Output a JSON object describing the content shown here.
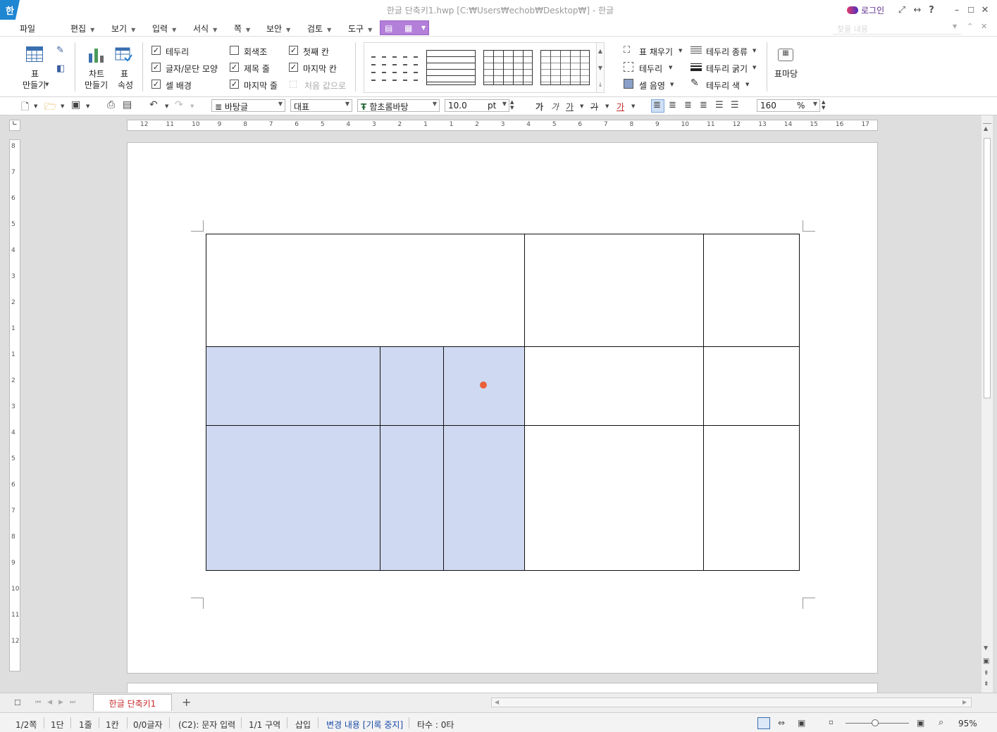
{
  "window": {
    "title": "한글 단축키1.hwp [C:₩Users₩echob₩Desktop₩] - 한글",
    "app_logo": "한",
    "login_label": "로그인"
  },
  "menu": [
    {
      "label": "파일",
      "dropdown": false
    },
    {
      "label": "편집",
      "dropdown": true
    },
    {
      "label": "보기",
      "dropdown": true
    },
    {
      "label": "입력",
      "dropdown": true
    },
    {
      "label": "서식",
      "dropdown": true
    },
    {
      "label": "쪽",
      "dropdown": true
    },
    {
      "label": "보안",
      "dropdown": true
    },
    {
      "label": "검토",
      "dropdown": true
    },
    {
      "label": "도구",
      "dropdown": true
    }
  ],
  "search_placeholder": "찾을 내용",
  "ribbon": {
    "table_create": {
      "line1": "표",
      "line2": "만들기"
    },
    "chart_create": {
      "line1": "차트",
      "line2": "만들기"
    },
    "table_props": {
      "line1": "표",
      "line2": "속성"
    },
    "checks": [
      {
        "label": "테두리",
        "checked": true
      },
      {
        "label": "글자/문단 모양",
        "checked": true
      },
      {
        "label": "셀 배경",
        "checked": true
      },
      {
        "label": "회색조",
        "checked": false
      },
      {
        "label": "제목 줄",
        "checked": true
      },
      {
        "label": "마지막 줄",
        "checked": true
      },
      {
        "label": "첫째 칸",
        "checked": true
      },
      {
        "label": "마지막 칸",
        "checked": true
      },
      {
        "label": "처음 값으로",
        "checked": false,
        "disabled": true
      }
    ],
    "fill": "표 채우기",
    "border": "테두리",
    "shade": "셀 음영",
    "border_type": "테두리 종류",
    "border_width": "테두리 굵기",
    "border_color": "테두리 색",
    "table_madang": "표마당"
  },
  "toolbar": {
    "style": "바탕글",
    "lang": "대표",
    "font": "함초롬바탕",
    "size": "10.0",
    "unit": "pt",
    "zoom": "160",
    "zoom_unit": "%",
    "bold": "가",
    "italic": "가",
    "underline": "가",
    "strike": "가",
    "color": "가"
  },
  "ruler_h": [
    "12",
    "11",
    "10",
    "9",
    "8",
    "7",
    "6",
    "5",
    "4",
    "3",
    "2",
    "1",
    "1",
    "2",
    "3",
    "4",
    "5",
    "6",
    "7",
    "8",
    "9",
    "10",
    "11",
    "12",
    "13",
    "14",
    "15",
    "16",
    "17"
  ],
  "ruler_v": [
    "8",
    "7",
    "6",
    "5",
    "4",
    "3",
    "2",
    "1",
    "1",
    "2",
    "3",
    "4",
    "5",
    "6",
    "7",
    "8",
    "9",
    "10",
    "11",
    "12"
  ],
  "doc_tab": "한글 단축키1",
  "status": {
    "page": "1/2쪽",
    "column": "1단",
    "line": "1줄",
    "cell": "1칸",
    "chars": "0/0글자",
    "mode": "(C2): 문자 입력",
    "section": "1/1 구역",
    "insert": "삽입",
    "track": "변경 내용 [기록 중지]",
    "typing": "타수 : 0타",
    "zoom": "95%"
  },
  "colors": {
    "accent": "#1f86d2",
    "selection": "#cfd9f1",
    "track_text": "#1a4aa8",
    "purple": "#b37fd9"
  }
}
